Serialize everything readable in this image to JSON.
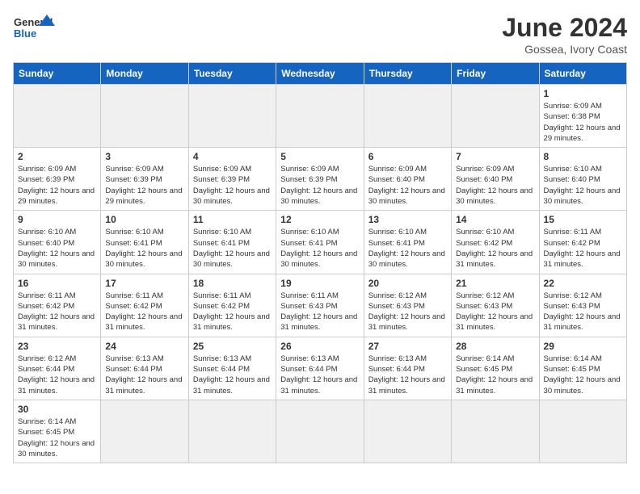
{
  "header": {
    "logo_general": "General",
    "logo_blue": "Blue",
    "month": "June 2024",
    "location": "Gossea, Ivory Coast"
  },
  "weekdays": [
    "Sunday",
    "Monday",
    "Tuesday",
    "Wednesday",
    "Thursday",
    "Friday",
    "Saturday"
  ],
  "weeks": [
    [
      {
        "day": "",
        "empty": true
      },
      {
        "day": "",
        "empty": true
      },
      {
        "day": "",
        "empty": true
      },
      {
        "day": "",
        "empty": true
      },
      {
        "day": "",
        "empty": true
      },
      {
        "day": "",
        "empty": true
      },
      {
        "day": "1",
        "sunrise": "6:09 AM",
        "sunset": "6:38 PM",
        "daylight": "12 hours and 29 minutes."
      }
    ],
    [
      {
        "day": "2",
        "sunrise": "6:09 AM",
        "sunset": "6:39 PM",
        "daylight": "12 hours and 29 minutes."
      },
      {
        "day": "3",
        "sunrise": "6:09 AM",
        "sunset": "6:39 PM",
        "daylight": "12 hours and 29 minutes."
      },
      {
        "day": "4",
        "sunrise": "6:09 AM",
        "sunset": "6:39 PM",
        "daylight": "12 hours and 30 minutes."
      },
      {
        "day": "5",
        "sunrise": "6:09 AM",
        "sunset": "6:39 PM",
        "daylight": "12 hours and 30 minutes."
      },
      {
        "day": "6",
        "sunrise": "6:09 AM",
        "sunset": "6:40 PM",
        "daylight": "12 hours and 30 minutes."
      },
      {
        "day": "7",
        "sunrise": "6:09 AM",
        "sunset": "6:40 PM",
        "daylight": "12 hours and 30 minutes."
      },
      {
        "day": "8",
        "sunrise": "6:10 AM",
        "sunset": "6:40 PM",
        "daylight": "12 hours and 30 minutes."
      }
    ],
    [
      {
        "day": "9",
        "sunrise": "6:10 AM",
        "sunset": "6:40 PM",
        "daylight": "12 hours and 30 minutes."
      },
      {
        "day": "10",
        "sunrise": "6:10 AM",
        "sunset": "6:41 PM",
        "daylight": "12 hours and 30 minutes."
      },
      {
        "day": "11",
        "sunrise": "6:10 AM",
        "sunset": "6:41 PM",
        "daylight": "12 hours and 30 minutes."
      },
      {
        "day": "12",
        "sunrise": "6:10 AM",
        "sunset": "6:41 PM",
        "daylight": "12 hours and 30 minutes."
      },
      {
        "day": "13",
        "sunrise": "6:10 AM",
        "sunset": "6:41 PM",
        "daylight": "12 hours and 30 minutes."
      },
      {
        "day": "14",
        "sunrise": "6:10 AM",
        "sunset": "6:42 PM",
        "daylight": "12 hours and 31 minutes."
      },
      {
        "day": "15",
        "sunrise": "6:11 AM",
        "sunset": "6:42 PM",
        "daylight": "12 hours and 31 minutes."
      }
    ],
    [
      {
        "day": "16",
        "sunrise": "6:11 AM",
        "sunset": "6:42 PM",
        "daylight": "12 hours and 31 minutes."
      },
      {
        "day": "17",
        "sunrise": "6:11 AM",
        "sunset": "6:42 PM",
        "daylight": "12 hours and 31 minutes."
      },
      {
        "day": "18",
        "sunrise": "6:11 AM",
        "sunset": "6:42 PM",
        "daylight": "12 hours and 31 minutes."
      },
      {
        "day": "19",
        "sunrise": "6:11 AM",
        "sunset": "6:43 PM",
        "daylight": "12 hours and 31 minutes."
      },
      {
        "day": "20",
        "sunrise": "6:12 AM",
        "sunset": "6:43 PM",
        "daylight": "12 hours and 31 minutes."
      },
      {
        "day": "21",
        "sunrise": "6:12 AM",
        "sunset": "6:43 PM",
        "daylight": "12 hours and 31 minutes."
      },
      {
        "day": "22",
        "sunrise": "6:12 AM",
        "sunset": "6:43 PM",
        "daylight": "12 hours and 31 minutes."
      }
    ],
    [
      {
        "day": "23",
        "sunrise": "6:12 AM",
        "sunset": "6:44 PM",
        "daylight": "12 hours and 31 minutes."
      },
      {
        "day": "24",
        "sunrise": "6:13 AM",
        "sunset": "6:44 PM",
        "daylight": "12 hours and 31 minutes."
      },
      {
        "day": "25",
        "sunrise": "6:13 AM",
        "sunset": "6:44 PM",
        "daylight": "12 hours and 31 minutes."
      },
      {
        "day": "26",
        "sunrise": "6:13 AM",
        "sunset": "6:44 PM",
        "daylight": "12 hours and 31 minutes."
      },
      {
        "day": "27",
        "sunrise": "6:13 AM",
        "sunset": "6:44 PM",
        "daylight": "12 hours and 31 minutes."
      },
      {
        "day": "28",
        "sunrise": "6:14 AM",
        "sunset": "6:45 PM",
        "daylight": "12 hours and 31 minutes."
      },
      {
        "day": "29",
        "sunrise": "6:14 AM",
        "sunset": "6:45 PM",
        "daylight": "12 hours and 30 minutes."
      }
    ],
    [
      {
        "day": "30",
        "sunrise": "6:14 AM",
        "sunset": "6:45 PM",
        "daylight": "12 hours and 30 minutes."
      },
      {
        "day": "",
        "empty": true
      },
      {
        "day": "",
        "empty": true
      },
      {
        "day": "",
        "empty": true
      },
      {
        "day": "",
        "empty": true
      },
      {
        "day": "",
        "empty": true
      },
      {
        "day": "",
        "empty": true
      }
    ]
  ]
}
